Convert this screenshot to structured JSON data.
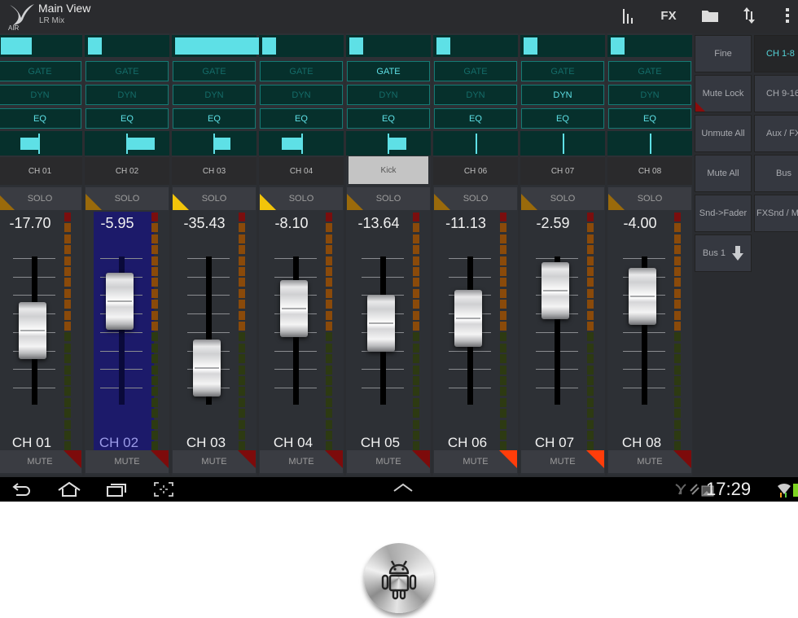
{
  "header": {
    "title": "Main View",
    "subtitle": "LR Mix",
    "logo": "x-air-logo",
    "toolbar": [
      {
        "icon": "meters-icon",
        "label": ""
      },
      {
        "icon": "fx-icon",
        "label": "FX"
      },
      {
        "icon": "folder-icon",
        "label": ""
      },
      {
        "icon": "sync-arrows-icon",
        "label": ""
      },
      {
        "icon": "overflow-menu-icon",
        "label": ""
      }
    ]
  },
  "channels": [
    {
      "name": "CH 01",
      "label": "CH 01",
      "value": "-17.70",
      "gate": "GATE",
      "dyn": "DYN",
      "eq": "EQ",
      "solo": "SOLO",
      "mute": "MUTE",
      "gate_on": false,
      "dyn_on": false,
      "eq_on": true,
      "solo_on": false,
      "mute_on": false,
      "selected": false,
      "name_selected": false,
      "fader_pos": 0.5
    },
    {
      "name": "CH 02",
      "label": "CH 02",
      "value": "-5.95",
      "gate": "GATE",
      "dyn": "DYN",
      "eq": "EQ",
      "solo": "SOLO",
      "mute": "MUTE",
      "gate_on": false,
      "dyn_on": false,
      "eq_on": true,
      "solo_on": false,
      "mute_on": false,
      "selected": true,
      "name_selected": false,
      "fader_pos": 0.7
    },
    {
      "name": "CH 03",
      "label": "CH 03",
      "value": "-35.43",
      "gate": "GATE",
      "dyn": "DYN",
      "eq": "EQ",
      "solo": "SOLO",
      "mute": "MUTE",
      "gate_on": false,
      "dyn_on": false,
      "eq_on": true,
      "solo_on": true,
      "mute_on": false,
      "selected": false,
      "name_selected": false,
      "fader_pos": 0.25
    },
    {
      "name": "CH 04",
      "label": "CH 04",
      "value": "-8.10",
      "gate": "GATE",
      "dyn": "DYN",
      "eq": "EQ",
      "solo": "SOLO",
      "mute": "MUTE",
      "gate_on": false,
      "dyn_on": false,
      "eq_on": true,
      "solo_on": true,
      "mute_on": false,
      "selected": false,
      "name_selected": false,
      "fader_pos": 0.65
    },
    {
      "name": "Kick",
      "label": "CH 05",
      "value": "-13.64",
      "gate": "GATE",
      "dyn": "DYN",
      "eq": "EQ",
      "solo": "SOLO",
      "mute": "MUTE",
      "gate_on": true,
      "dyn_on": false,
      "eq_on": true,
      "solo_on": false,
      "mute_on": false,
      "selected": false,
      "name_selected": true,
      "fader_pos": 0.55
    },
    {
      "name": "CH 06",
      "label": "CH 06",
      "value": "-11.13",
      "gate": "GATE",
      "dyn": "DYN",
      "eq": "EQ",
      "solo": "SOLO",
      "mute": "MUTE",
      "gate_on": false,
      "dyn_on": false,
      "eq_on": true,
      "solo_on": false,
      "mute_on": true,
      "selected": false,
      "name_selected": false,
      "fader_pos": 0.58
    },
    {
      "name": "CH 07",
      "label": "CH 07",
      "value": "-2.59",
      "gate": "GATE",
      "dyn": "DYN",
      "eq": "EQ",
      "solo": "SOLO",
      "mute": "MUTE",
      "gate_on": false,
      "dyn_on": true,
      "eq_on": true,
      "solo_on": false,
      "mute_on": true,
      "selected": false,
      "name_selected": false,
      "fader_pos": 0.77
    },
    {
      "name": "CH 08",
      "label": "CH 08",
      "value": "-4.00",
      "gate": "GATE",
      "dyn": "DYN",
      "eq": "EQ",
      "solo": "SOLO",
      "mute": "MUTE",
      "gate_on": false,
      "dyn_on": false,
      "eq_on": true,
      "solo_on": false,
      "mute_on": false,
      "selected": false,
      "name_selected": false,
      "fader_pos": 0.73
    }
  ],
  "right_panel": {
    "left_column": [
      {
        "label": "Fine"
      },
      {
        "label": "Mute Lock"
      },
      {
        "label": "Unmute All"
      },
      {
        "label": "Mute All"
      },
      {
        "label": "Snd->Fader"
      },
      {
        "label": "Bus 1"
      }
    ],
    "right_column": [
      {
        "label": "CH 1-8",
        "active": true
      },
      {
        "label": "CH 9-16",
        "active": false
      },
      {
        "label": "Aux / FX",
        "active": false
      },
      {
        "label": "Bus",
        "active": false
      },
      {
        "label": "FXSnd / Main",
        "active": false
      }
    ]
  },
  "system_bar": {
    "time": "17:29",
    "nav": [
      "back-icon",
      "home-icon",
      "recents-icon",
      "screenshot-icon"
    ],
    "center": "chevron-up-icon",
    "status": [
      "x-air-notification-icon",
      "sync-off-icon",
      "image-icon",
      "wifi-icon",
      "battery-icon"
    ]
  },
  "launcher": {
    "icon": "android-icon"
  },
  "colors": {
    "accent": "#5ee0e6",
    "selected_strip": "#1c1a6a",
    "solo_on": "#f2c40a",
    "solo_off": "#9a6a0b",
    "mute_on": "#ff3d0a",
    "mute_off": "#7d0b0b"
  }
}
